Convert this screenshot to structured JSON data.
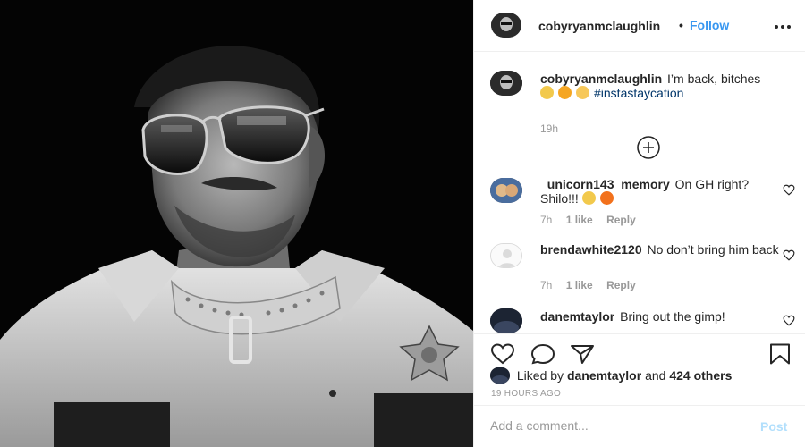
{
  "post": {
    "author": "cobyryanmclaughlin",
    "separator": "•",
    "follow_label": "Follow",
    "caption_text": "I’m back, bitches",
    "caption_hashtag": "#instastaycation",
    "caption_emojis": [
      "raised-fists-emoji",
      "winking-kiss-emoji",
      "flushed-face-emoji"
    ],
    "caption_time": "19h"
  },
  "comments": [
    {
      "username": "_unicorn143_memory",
      "text": "On GH right? Shilo!!!",
      "emojis": [
        "raising-hands-emoji",
        "fire-emoji"
      ],
      "time": "7h",
      "likes": "1 like",
      "reply": "Reply"
    },
    {
      "username": "brendawhite2120",
      "text": "No don’t bring him back",
      "time": "7h",
      "likes": "1 like",
      "reply": "Reply"
    },
    {
      "username": "danemtaylor",
      "text": "Bring out the gimp!"
    }
  ],
  "likes": {
    "prefix": "Liked by",
    "user": "danemtaylor",
    "conjunction": "and",
    "others": "424 others"
  },
  "posted_ago": "19 HOURS AGO",
  "add_comment": {
    "placeholder": "Add a comment...",
    "post_label": "Post"
  },
  "colors": {
    "accent": "#3897f0",
    "hashtag": "#003569",
    "muted": "#999999",
    "post_disabled": "#b2dffc"
  }
}
